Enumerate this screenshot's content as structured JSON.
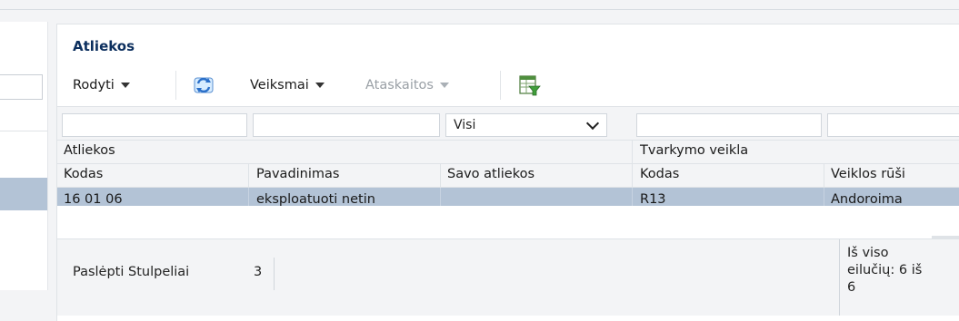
{
  "panel": {
    "title": "Atliekos"
  },
  "toolbar": {
    "view_label": "Rodyti",
    "refresh_icon": "refresh-icon",
    "actions_label": "Veiksmai",
    "reports_label": "Ataskaitos",
    "export_icon": "excel-filter-icon"
  },
  "filters": {
    "own_waste_selected": "Visi"
  },
  "grid": {
    "groups": [
      "Atliekos",
      "Tvarkymo veikla"
    ],
    "columns": [
      "Kodas",
      "Pavadinimas",
      "Savo atliekos",
      "Kodas",
      "Veiklos rūši"
    ],
    "rows": [
      [
        "16 01 06",
        "eksploatuoti netin",
        "",
        "R13",
        "Andoroima"
      ]
    ]
  },
  "footer": {
    "hidden_columns_label": "Paslėpti Stulpeliai",
    "hidden_columns_count": "3",
    "total_line1": "Iš viso",
    "total_line2": "eilučių: 6 iš",
    "total_line3": "6"
  },
  "colors": {
    "title": "#0c2f5e",
    "selected_row": "#b3c3d6",
    "panel_bg": "#f3f4f6"
  }
}
